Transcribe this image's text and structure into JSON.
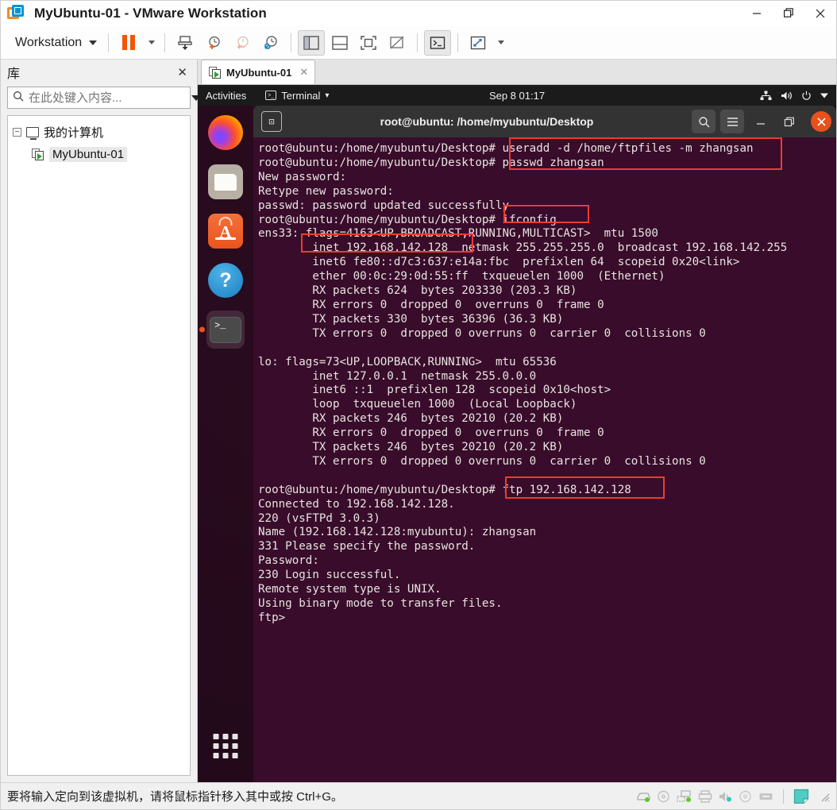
{
  "window": {
    "title": "MyUbuntu-01 - VMware Workstation",
    "logo_icon": "vmware-logo-icon",
    "controls": {
      "minimize": "—",
      "restore": "❐",
      "close": "✕"
    }
  },
  "toolbar": {
    "menu_label": "Workstation",
    "items": [
      {
        "name": "suspend-button",
        "icon": "pause-icon"
      },
      {
        "name": "suspend-dropdown",
        "icon": "chevron-down-icon"
      },
      {
        "name": "power-button",
        "icon": "power-down-icon"
      },
      {
        "name": "snapshot-take-button",
        "icon": "snapshot-add-icon"
      },
      {
        "name": "snapshot-revert-button",
        "icon": "snapshot-revert-icon"
      },
      {
        "name": "snapshot-manager-button",
        "icon": "snapshot-manager-icon"
      },
      {
        "name": "show-library-button",
        "icon": "sidebar-panel-icon"
      },
      {
        "name": "show-thumbnails-button",
        "icon": "bottom-panel-icon"
      },
      {
        "name": "fullscreen-button",
        "icon": "fullscreen-icon"
      },
      {
        "name": "unity-mode-button",
        "icon": "unity-mode-icon"
      },
      {
        "name": "console-view-button",
        "icon": "console-icon"
      },
      {
        "name": "stretch-button",
        "icon": "expand-arrows-icon"
      },
      {
        "name": "stretch-dropdown",
        "icon": "chevron-down-icon"
      }
    ]
  },
  "sidebar": {
    "title": "库",
    "close_label": "✕",
    "search": {
      "placeholder": "在此处键入内容...",
      "value": "",
      "icon": "search-icon",
      "dropdown_icon": "chevron-down-icon"
    },
    "tree": [
      {
        "label": "我的计算机",
        "icon": "monitor-icon",
        "expander": "−",
        "selected": false
      },
      {
        "label": "MyUbuntu-01",
        "icon": "vm-running-icon",
        "selected": true
      }
    ]
  },
  "vm_tab": {
    "label": "MyUbuntu-01",
    "icon": "vm-running-icon",
    "close_label": "✕"
  },
  "guest": {
    "topbar": {
      "activities": "Activities",
      "app_menu": "Terminal",
      "app_menu_icon": "terminal-icon",
      "app_menu_caret": "▾",
      "clock": "Sep 8 01:17",
      "tray": [
        {
          "name": "network-icon",
          "glyph": "⛓"
        },
        {
          "name": "volume-icon",
          "glyph": "🔊"
        },
        {
          "name": "power-icon",
          "glyph": "⏻"
        },
        {
          "name": "chevron-down-icon",
          "glyph": "▾"
        }
      ]
    },
    "dock": [
      {
        "name": "dock-item-firefox",
        "icon": "firefox-icon",
        "active": false
      },
      {
        "name": "dock-item-files",
        "icon": "files-icon",
        "active": false
      },
      {
        "name": "dock-item-ubuntu-software",
        "icon": "ubuntu-software-icon",
        "active": false
      },
      {
        "name": "dock-item-help",
        "icon": "help-icon",
        "active": false
      },
      {
        "name": "dock-item-terminal",
        "icon": "terminal-icon",
        "active": true
      }
    ],
    "show_apps_icon": "app-grid-icon"
  },
  "terminal": {
    "title": "root@ubuntu: /home/myubuntu/Desktop",
    "new_tab_icon": "new-tab-icon",
    "search_icon": "search-icon",
    "menu_icon": "hamburger-menu-icon",
    "minimize_icon": "minimize-icon",
    "maximize_icon": "maximize-icon",
    "close_icon": "close-icon",
    "content": "root@ubuntu:/home/myubuntu/Desktop# useradd -d /home/ftpfiles -m zhangsan\nroot@ubuntu:/home/myubuntu/Desktop# passwd zhangsan\nNew password:\nRetype new password:\npasswd: password updated successfully\nroot@ubuntu:/home/myubuntu/Desktop# ifconfig\nens33: flags=4163<UP,BROADCAST,RUNNING,MULTICAST>  mtu 1500\n        inet 192.168.142.128  netmask 255.255.255.0  broadcast 192.168.142.255\n        inet6 fe80::d7c3:637:e14a:fbc  prefixlen 64  scopeid 0x20<link>\n        ether 00:0c:29:0d:55:ff  txqueuelen 1000  (Ethernet)\n        RX packets 624  bytes 203330 (203.3 KB)\n        RX errors 0  dropped 0  overruns 0  frame 0\n        TX packets 330  bytes 36396 (36.3 KB)\n        TX errors 0  dropped 0 overruns 0  carrier 0  collisions 0\n\nlo: flags=73<UP,LOOPBACK,RUNNING>  mtu 65536\n        inet 127.0.0.1  netmask 255.0.0.0\n        inet6 ::1  prefixlen 128  scopeid 0x10<host>\n        loop  txqueuelen 1000  (Local Loopback)\n        RX packets 246  bytes 20210 (20.2 KB)\n        RX errors 0  dropped 0  overruns 0  frame 0\n        TX packets 246  bytes 20210 (20.2 KB)\n        TX errors 0  dropped 0 overruns 0  carrier 0  collisions 0\n\nroot@ubuntu:/home/myubuntu/Desktop# ftp 192.168.142.128\nConnected to 192.168.142.128.\n220 (vsFTPd 3.0.3)\nName (192.168.142.128:myubuntu): zhangsan\n331 Please specify the password.\nPassword:\n230 Login successful.\nRemote system type is UNIX.\nUsing binary mode to transfer files.\nftp>",
    "annotations": [
      {
        "name": "annotation-useradd-passwd",
        "text": "useradd -d /home/ftpfiles -m zhangsan / passwd zhangsan",
        "color": "#ec3b33"
      },
      {
        "name": "annotation-ifconfig",
        "text": "ifconfig",
        "color": "#ec3b33"
      },
      {
        "name": "annotation-inet-address",
        "text": "inet 192.168.142.128",
        "color": "#ec3b33"
      },
      {
        "name": "annotation-ftp-command",
        "text": "ftp 192.168.142.128",
        "color": "#ec3b33"
      }
    ]
  },
  "statusbar": {
    "message": "要将输入定向到该虚拟机，请将鼠标指针移入其中或按 Ctrl+G。",
    "devices": [
      {
        "name": "hard-disk-icon"
      },
      {
        "name": "cd-dvd-icon"
      },
      {
        "name": "network-adapter-icon"
      },
      {
        "name": "printer-icon"
      },
      {
        "name": "sound-card-icon"
      },
      {
        "name": "optical-drive-icon"
      },
      {
        "name": "usb-icon"
      },
      {
        "name": "note-icon"
      }
    ],
    "resize_grip_icon": "resize-grip-icon"
  }
}
